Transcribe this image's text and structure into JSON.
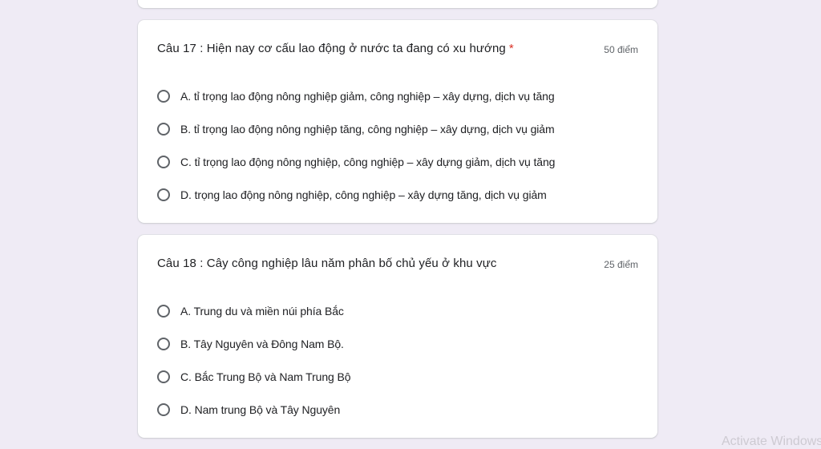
{
  "questions": [
    {
      "title": "Câu 17 : Hiện nay cơ cấu lao động ở nước ta đang có xu hướng",
      "required_mark": "*",
      "points": "50 điểm",
      "options": [
        "A. tỉ trọng lao động nông nghiệp giảm, công nghiệp – xây dựng, dịch vụ tăng",
        "B. tỉ trọng lao động nông nghiệp tăng, công nghiệp – xây dựng, dịch vụ giảm",
        "C. tỉ trọng lao động nông nghiệp, công nghiệp – xây dựng giảm, dịch vụ tăng",
        "D. trọng lao động nông nghiệp, công nghiệp – xây dựng tăng, dịch vụ giảm"
      ]
    },
    {
      "title": "Câu 18 : Cây công nghiệp lâu năm phân bố chủ yếu ở khu vực",
      "points": "25 điểm",
      "options": [
        "A. Trung du và miền núi phía Bắc",
        "B. Tây Nguyên và Đông Nam Bộ.",
        "C. Bắc Trung Bộ và Nam Trung Bộ",
        "D. Nam trung Bộ và Tây Nguyên"
      ]
    }
  ],
  "watermark": "Activate Windows",
  "colors": {
    "background": "#efebf5",
    "card": "#ffffff",
    "required": "#d93025",
    "text": "#202124",
    "muted": "#5f6368"
  }
}
